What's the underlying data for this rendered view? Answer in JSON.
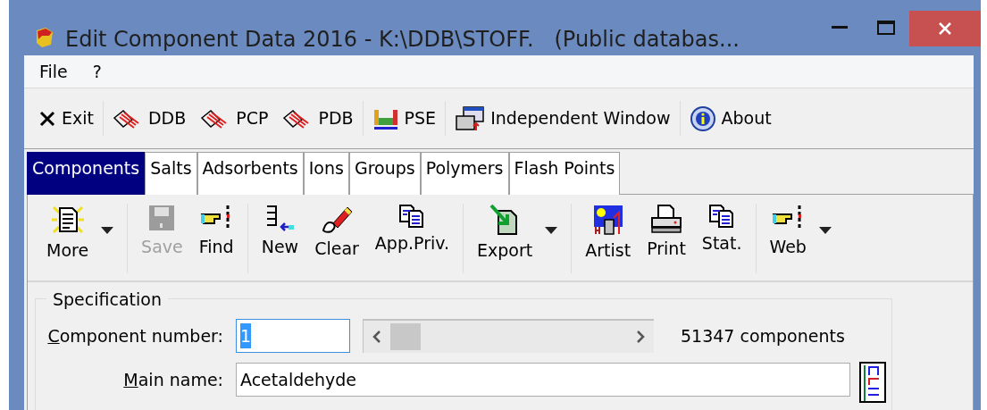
{
  "window": {
    "title": "Edit Component Data 2016 - K:\\DDB\\STOFF.   (Public databas..."
  },
  "menu": [
    "File",
    "?"
  ],
  "toolbar": [
    {
      "kind": "exit",
      "label": "Exit"
    },
    {
      "kind": "db",
      "label": "DDB"
    },
    {
      "kind": "db",
      "label": "PCP"
    },
    {
      "kind": "db",
      "label": "PDB"
    },
    {
      "kind": "pse",
      "label": "PSE"
    },
    {
      "kind": "window",
      "label": "Independent Window"
    },
    {
      "kind": "about",
      "label": "About"
    }
  ],
  "tabs": [
    {
      "label": "Components",
      "selected": true
    },
    {
      "label": "Salts",
      "selected": false
    },
    {
      "label": "Adsorbents",
      "selected": false
    },
    {
      "label": "Ions",
      "selected": false
    },
    {
      "label": "Groups",
      "selected": false
    },
    {
      "label": "Polymers",
      "selected": false
    },
    {
      "label": "Flash Points",
      "selected": false
    }
  ],
  "actions": [
    {
      "kind": "more",
      "label": "More",
      "disabled": false,
      "dropdown": true
    },
    {
      "kind": "save",
      "label": "Save",
      "disabled": true,
      "dropdown": false
    },
    {
      "kind": "find",
      "label": "Find",
      "disabled": false,
      "dropdown": false
    },
    {
      "kind": "new",
      "label": "New",
      "disabled": false,
      "dropdown": false
    },
    {
      "kind": "clear",
      "label": "Clear",
      "disabled": false,
      "dropdown": false
    },
    {
      "kind": "copy",
      "label": "App.Priv.",
      "disabled": false,
      "dropdown": false
    },
    {
      "kind": "export",
      "label": "Export",
      "disabled": false,
      "dropdown": true
    },
    {
      "kind": "artist",
      "label": "Artist",
      "disabled": false,
      "dropdown": false
    },
    {
      "kind": "print",
      "label": "Print",
      "disabled": false,
      "dropdown": false
    },
    {
      "kind": "copy",
      "label": "Stat.",
      "disabled": false,
      "dropdown": false
    },
    {
      "kind": "find",
      "label": "Web",
      "disabled": false,
      "dropdown": true
    }
  ],
  "specification": {
    "title": "Specification",
    "component_number": {
      "label": "Component number:",
      "value": "1",
      "text_selected": true
    },
    "count": "51347 components",
    "main_name": {
      "label": "Main name:",
      "value": "Acetaldehyde"
    }
  }
}
